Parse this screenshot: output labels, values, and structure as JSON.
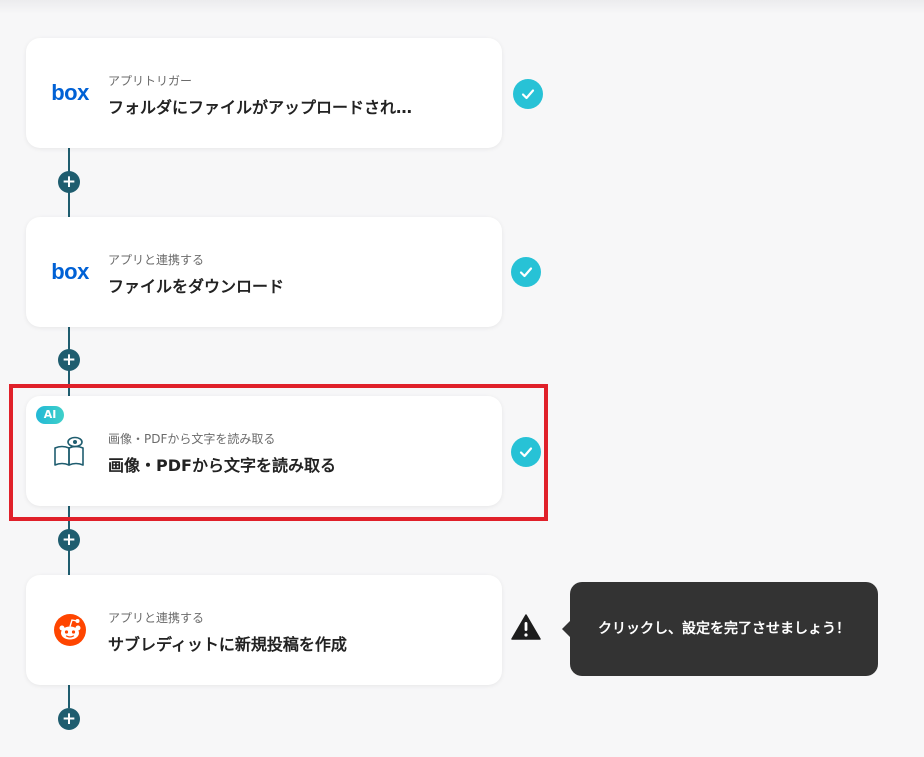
{
  "steps": [
    {
      "app_icon": "box-logo",
      "logo_text": "box",
      "category": "アプリトリガー",
      "title": "フォルダにファイルがアップロードされ…",
      "status": "complete"
    },
    {
      "app_icon": "box-logo",
      "logo_text": "box",
      "category": "アプリと連携する",
      "title": "ファイルをダウンロード",
      "status": "complete"
    },
    {
      "app_icon": "ocr-book-eye-icon",
      "badge": "AI",
      "category": "画像・PDFから文字を読み取る",
      "title": "画像・PDFから文字を読み取る",
      "status": "complete",
      "highlighted": true
    },
    {
      "app_icon": "reddit-icon",
      "category": "アプリと連携する",
      "title": "サブレディットに新規投稿を作成",
      "status": "warning"
    }
  ],
  "add_step_icon": "+",
  "tooltip": {
    "text": "クリックし、設定を完了させましょう！"
  },
  "colors": {
    "connector": "#1f5d6f",
    "check": "#27c2d6",
    "highlight": "#e0202a",
    "box_brand": "#0061d5",
    "reddit": "#ff4500",
    "tooltip_bg": "#333333"
  }
}
